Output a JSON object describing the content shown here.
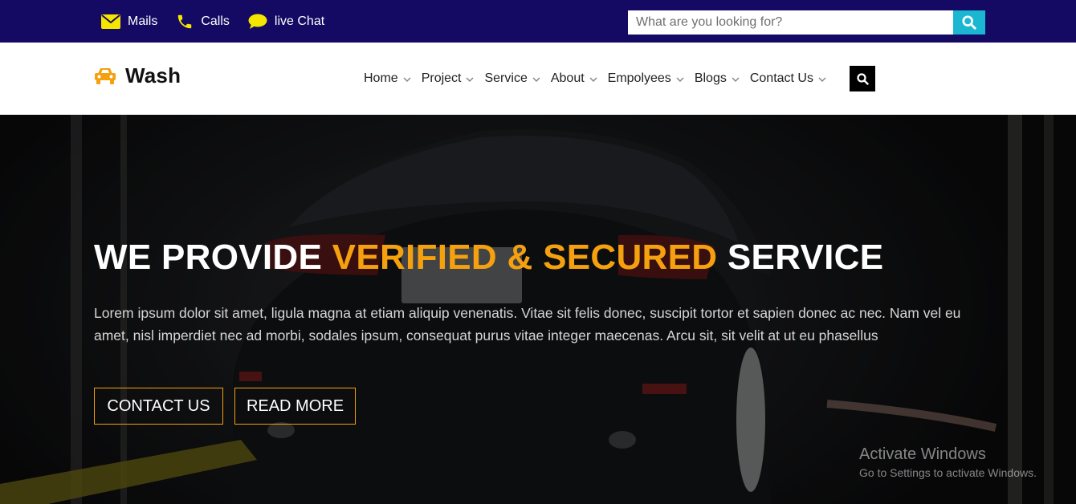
{
  "topbar": {
    "links": [
      {
        "label": "Mails",
        "icon": "envelope-icon"
      },
      {
        "label": "Calls",
        "icon": "phone-icon"
      },
      {
        "label": "live Chat",
        "icon": "chat-bubble-icon"
      }
    ],
    "search_placeholder": "What are you looking for?",
    "icon_color": "#f5e600",
    "background": "#140a63",
    "search_button_color": "#1ab6d2"
  },
  "navbar": {
    "logo": "Wash",
    "logo_icon": "car-icon",
    "menu": [
      "Home",
      "Project",
      "Service",
      "About",
      "Empolyees",
      "Blogs",
      "Contact Us"
    ]
  },
  "hero": {
    "title_part1": "WE PROVIDE ",
    "title_accent": "VERIFIED & SECURED",
    "title_part2": " SERVICE",
    "text": "Lorem ipsum dolor sit amet, ligula magna at etiam aliquip venenatis. Vitae sit felis donec, suscipit tortor et sapien donec ac nec. Nam vel eu amet, nisl imperdiet nec ad morbi, sodales ipsum, consequat purus vitae integer maecenas. Arcu sit, sit velit at ut eu phasellus",
    "buttons": [
      "CONTACT US",
      "READ MORE"
    ],
    "accent_color": "#f5a00e"
  },
  "watermark": {
    "line1": "Activate Windows",
    "line2": "Go to Settings to activate Windows."
  }
}
